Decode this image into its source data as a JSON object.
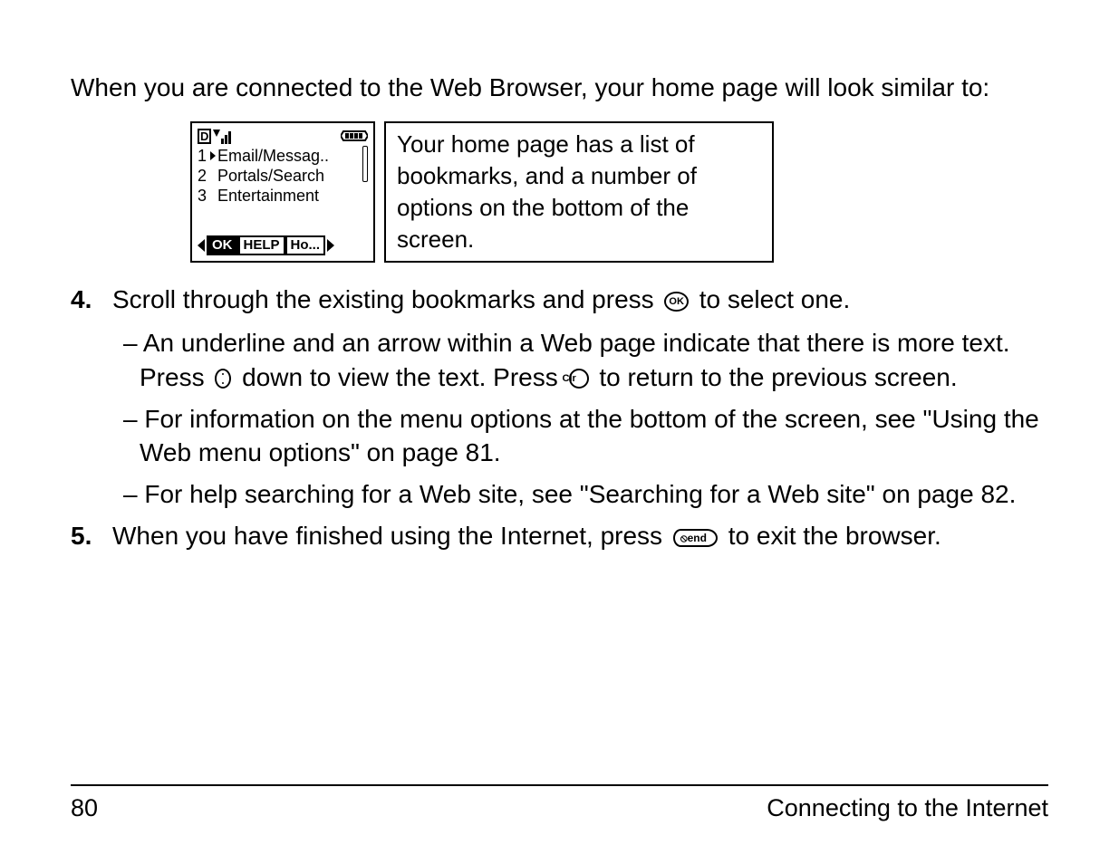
{
  "intro": "When you are connected to the Web Browser, your home page will look similar to:",
  "phone": {
    "status": {
      "d_label": "D"
    },
    "bookmarks": [
      {
        "num": "1",
        "label": "Email/Messag..",
        "selected": true
      },
      {
        "num": "2",
        "label": "Portals/Search",
        "selected": false
      },
      {
        "num": "3",
        "label": "Entertainment",
        "selected": false
      }
    ],
    "softkeys": {
      "left": "OK",
      "center": "HELP",
      "right": "Ho..."
    }
  },
  "caption": "Your home page has a list of bookmarks, and a number of options on the bottom of the screen.",
  "steps": {
    "s4": {
      "num": "4.",
      "text_before_icon": "Scroll through the existing bookmarks and press ",
      "ok_label": "OK",
      "text_after_icon": " to select one."
    },
    "s4_sub1": {
      "a": "An underline and an arrow within a Web page indicate that there is more text. Press ",
      "b": " down to view the text. Press ",
      "clr_label": "Clr",
      "c": " to return to the previous screen."
    },
    "s4_sub2": "For information on the menu options at the bottom of the screen, see \"Using the Web menu options\" on page 81.",
    "s4_sub3": "For help searching for a Web site, see \"Searching for a Web site\" on page 82.",
    "s5": {
      "num": "5.",
      "a": "When you have finished using the Internet, press ",
      "end_label": "⦸end",
      "b": " to exit the browser."
    }
  },
  "footer": {
    "page_num": "80",
    "section": "Connecting to the Internet"
  }
}
